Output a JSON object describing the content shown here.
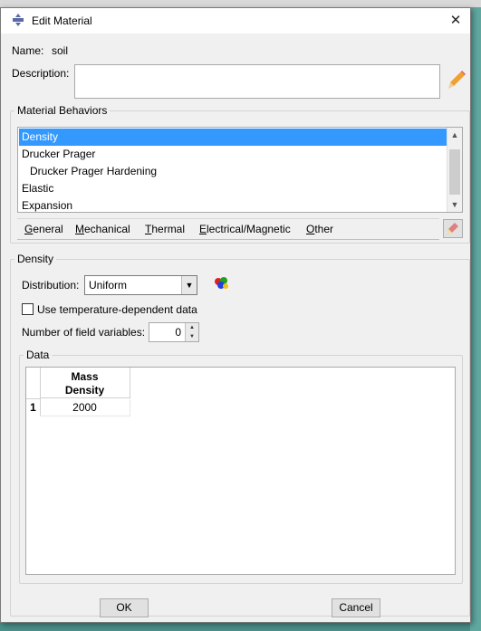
{
  "window": {
    "title": "Edit Material"
  },
  "name": {
    "label": "Name:",
    "value": "soil"
  },
  "description": {
    "label": "Description:",
    "value": ""
  },
  "behaviors": {
    "legend": "Material Behaviors",
    "items": [
      {
        "label": "Density",
        "selected": true
      },
      {
        "label": "Drucker Prager"
      },
      {
        "label": "Drucker Prager Hardening"
      },
      {
        "label": "Elastic"
      },
      {
        "label": "Expansion"
      }
    ],
    "menu": [
      {
        "label": "General"
      },
      {
        "label": "Mechanical"
      },
      {
        "label": "Thermal"
      },
      {
        "label": "Electrical/Magnetic"
      },
      {
        "label": "Other"
      }
    ]
  },
  "density": {
    "legend": "Density",
    "distribution_label": "Distribution:",
    "distribution_value": "Uniform",
    "temp_dependent_label": "Use temperature-dependent data",
    "temp_dependent_checked": false,
    "field_vars_label": "Number of field variables:",
    "field_vars_value": "0"
  },
  "data": {
    "legend": "Data",
    "column_header": "Mass Density",
    "rows": [
      {
        "index": "1",
        "value": "2000"
      }
    ]
  },
  "buttons": {
    "ok": "OK",
    "cancel": "Cancel"
  },
  "colors": {
    "selection": "#3399ff",
    "dialog_bg": "#f0f0f0",
    "desktop": "#4a8f8a"
  }
}
